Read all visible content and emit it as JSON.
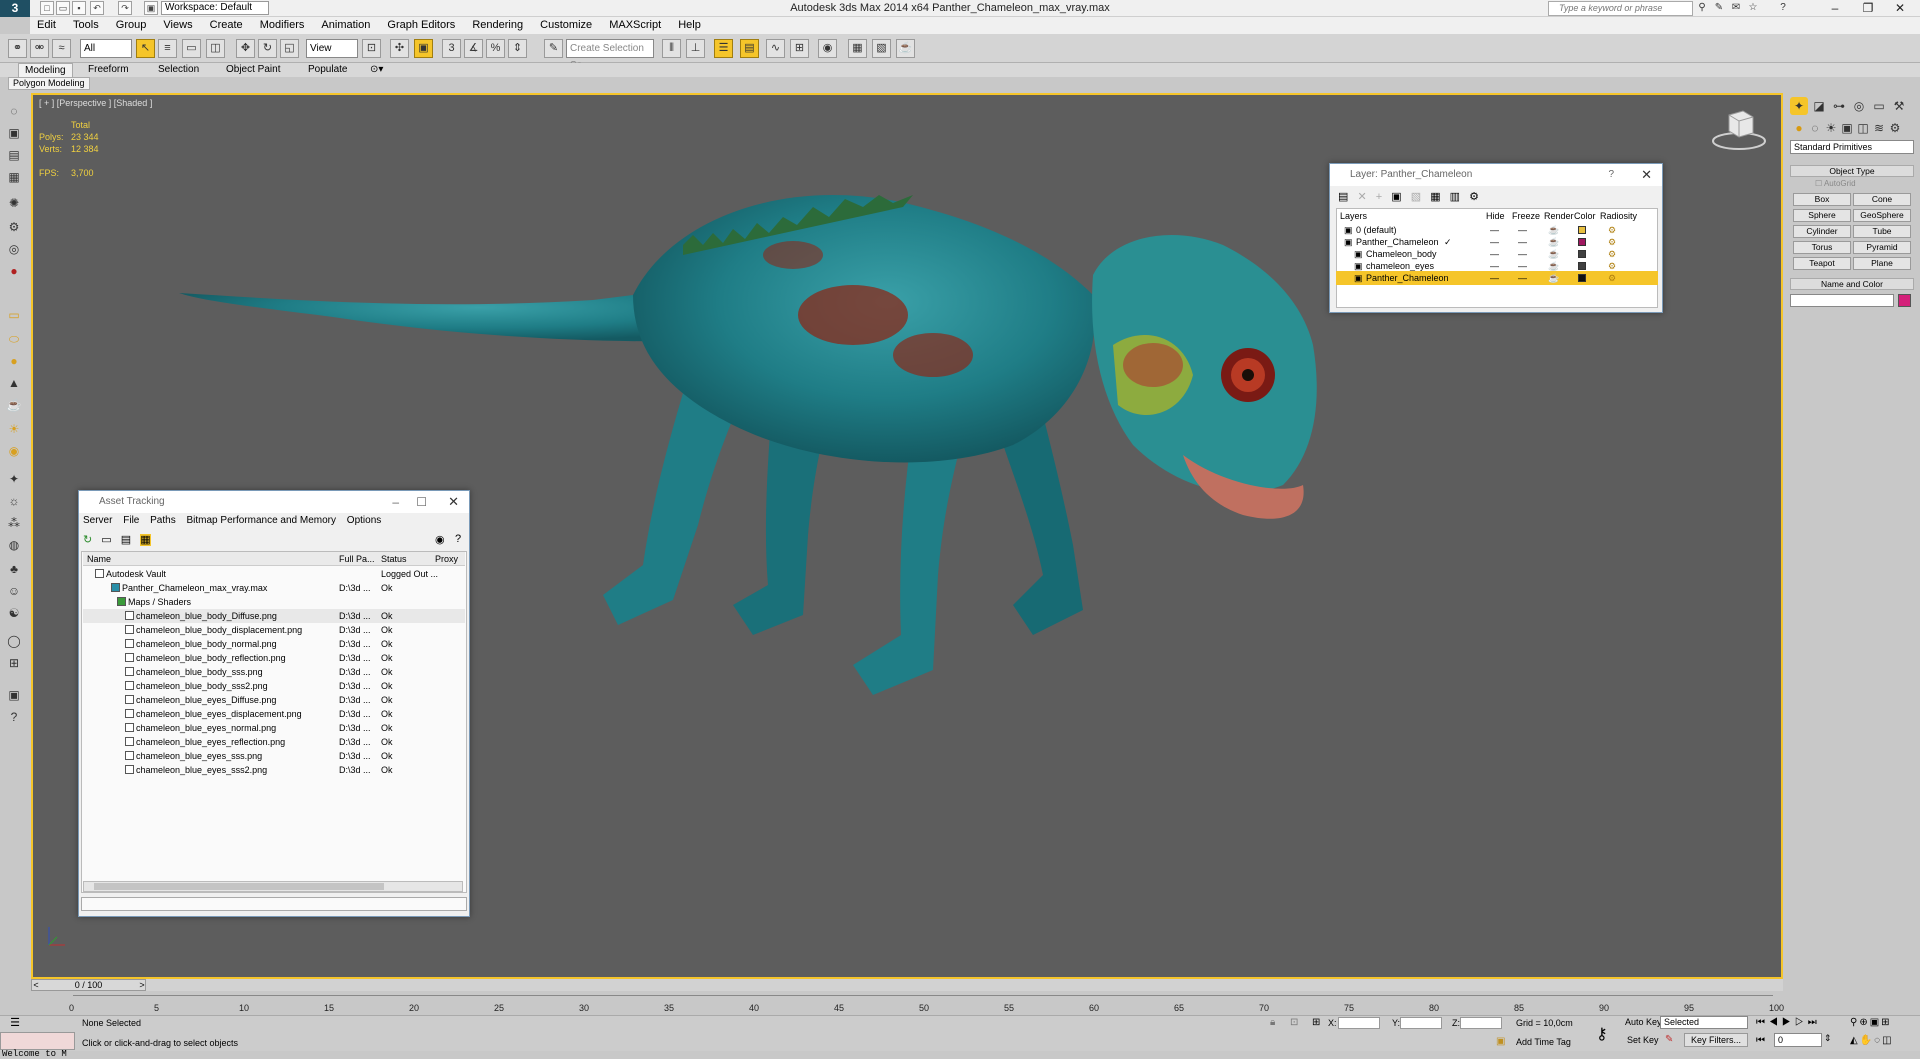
{
  "window": {
    "title": "Autodesk 3ds Max  2014 x64     Panther_Chameleon_max_vray.max",
    "workspace": "Workspace: Default",
    "search_placeholder": "Type a keyword or phrase"
  },
  "menu": [
    "Edit",
    "Tools",
    "Group",
    "Views",
    "Create",
    "Modifiers",
    "Animation",
    "Graph Editors",
    "Rendering",
    "Customize",
    "MAXScript",
    "Help"
  ],
  "toolbar": {
    "filter": "All",
    "ref_coord": "View",
    "named_selection": "Create Selection Se"
  },
  "ribbon": {
    "tabs": [
      "Modeling",
      "Freeform",
      "Selection",
      "Object Paint",
      "Populate"
    ],
    "active_panel": "Polygon Modeling"
  },
  "viewport": {
    "label": "[ + ] [Perspective ] [Shaded ]",
    "stats": {
      "total_label": "Total",
      "polys_label": "Polys:",
      "polys": "23 344",
      "verts_label": "Verts:",
      "verts": "12 384"
    },
    "fps_label": "FPS:",
    "fps": "3,700"
  },
  "layer_dialog": {
    "title": "Layer: Panther_Chameleon",
    "help": "?",
    "columns": [
      "Layers",
      "Hide",
      "Freeze",
      "Render",
      "Color",
      "Radiosity"
    ],
    "rows": [
      {
        "name": "0 (default)",
        "color": "#e8c040",
        "indent": 0
      },
      {
        "name": "Panther_Chameleon",
        "color": "#a01860",
        "indent": 0
      },
      {
        "name": "Chameleon_body",
        "color": "#404040",
        "indent": 1
      },
      {
        "name": "chameleon_eyes",
        "color": "#404040",
        "indent": 1
      },
      {
        "name": "Panther_Chameleon",
        "color": "#101010",
        "indent": 1,
        "selected": true
      }
    ]
  },
  "asset_dialog": {
    "title": "Asset Tracking",
    "menu": [
      "Server",
      "File",
      "Paths",
      "Bitmap Performance and Memory",
      "Options"
    ],
    "columns": [
      "Name",
      "Full Pa...",
      "Status",
      "Proxy"
    ],
    "rows": [
      {
        "name": "Autodesk Vault",
        "path": "",
        "status": "Logged Out ...",
        "indent": 0
      },
      {
        "name": "Panther_Chameleon_max_vray.max",
        "path": "D:\\3d ...",
        "status": "Ok",
        "indent": 1
      },
      {
        "name": "Maps / Shaders",
        "path": "",
        "status": "",
        "indent": 2
      },
      {
        "name": "chameleon_blue_body_Diffuse.png",
        "path": "D:\\3d ...",
        "status": "Ok",
        "indent": 3
      },
      {
        "name": "chameleon_blue_body_displacement.png",
        "path": "D:\\3d ...",
        "status": "Ok",
        "indent": 3
      },
      {
        "name": "chameleon_blue_body_normal.png",
        "path": "D:\\3d ...",
        "status": "Ok",
        "indent": 3
      },
      {
        "name": "chameleon_blue_body_reflection.png",
        "path": "D:\\3d ...",
        "status": "Ok",
        "indent": 3
      },
      {
        "name": "chameleon_blue_body_sss.png",
        "path": "D:\\3d ...",
        "status": "Ok",
        "indent": 3
      },
      {
        "name": "chameleon_blue_body_sss2.png",
        "path": "D:\\3d ...",
        "status": "Ok",
        "indent": 3
      },
      {
        "name": "chameleon_blue_eyes_Diffuse.png",
        "path": "D:\\3d ...",
        "status": "Ok",
        "indent": 3
      },
      {
        "name": "chameleon_blue_eyes_displacement.png",
        "path": "D:\\3d ...",
        "status": "Ok",
        "indent": 3
      },
      {
        "name": "chameleon_blue_eyes_normal.png",
        "path": "D:\\3d ...",
        "status": "Ok",
        "indent": 3
      },
      {
        "name": "chameleon_blue_eyes_reflection.png",
        "path": "D:\\3d ...",
        "status": "Ok",
        "indent": 3
      },
      {
        "name": "chameleon_blue_eyes_sss.png",
        "path": "D:\\3d ...",
        "status": "Ok",
        "indent": 3
      },
      {
        "name": "chameleon_blue_eyes_sss2.png",
        "path": "D:\\3d ...",
        "status": "Ok",
        "indent": 3
      }
    ]
  },
  "command_panel": {
    "category": "Standard Primitives",
    "object_type_label": "Object Type",
    "autogrid": "AutoGrid",
    "buttons": [
      "Box",
      "Cone",
      "Sphere",
      "GeoSphere",
      "Cylinder",
      "Tube",
      "Torus",
      "Pyramid",
      "Teapot",
      "Plane"
    ],
    "name_color_label": "Name and Color",
    "object_color": "#d4207a"
  },
  "timeline": {
    "frame": "0 / 100",
    "ticks": [
      "0",
      "5",
      "10",
      "15",
      "20",
      "25",
      "30",
      "35",
      "40",
      "45",
      "50",
      "55",
      "60",
      "65",
      "70",
      "75",
      "80",
      "85",
      "90",
      "95",
      "100"
    ]
  },
  "status": {
    "welcome": "Welcome to M",
    "selection": "None Selected",
    "prompt": "Click or click-and-drag to select objects",
    "x_label": "X:",
    "y_label": "Y:",
    "z_label": "Z:",
    "grid": "Grid = 10,0cm",
    "add_time_tag": "Add Time Tag",
    "auto_key": "Auto Key",
    "set_key": "Set Key",
    "key_mode": "Selected",
    "key_filters": "Key Filters...",
    "current_frame": "0"
  },
  "colors": {
    "accent_yellow": "#f5c52a",
    "viewport_bg": "#5d5d5d",
    "stats_yellow": "#f0d040"
  }
}
